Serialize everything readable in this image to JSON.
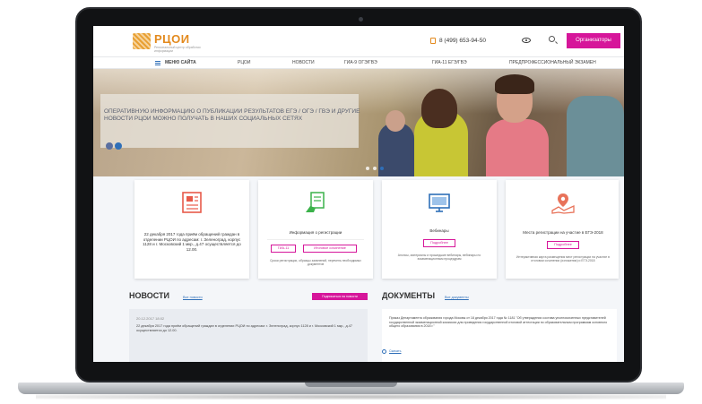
{
  "header": {
    "logo_text": "РЦОИ",
    "logo_sub": "Региональный центр обработки информации",
    "phone": "8 (499) 653-94-50",
    "organizers_label": "Организаторы"
  },
  "nav": {
    "items": [
      {
        "label": "МЕНЮ САЙТА"
      },
      {
        "label": "РЦОИ"
      },
      {
        "label": "НОВОСТИ"
      },
      {
        "label": "ГИА-9 ОГЭ/ГВЭ"
      },
      {
        "label": "ГИА-11 ЕГЭ/ГВЭ"
      },
      {
        "label": "ПРЕДПРОФЕССИОНАЛЬНЫЙ ЭКЗАМЕН"
      }
    ]
  },
  "hero": {
    "text": "ОПЕРАТИВНУЮ ИНФОРМАЦИЮ О ПУБЛИКАЦИИ РЕЗУЛЬТАТОВ ЕГЭ / ОГЭ / ГВЭ И ДРУГИЕ НОВОСТИ РЦОИ МОЖНО ПОЛУЧАТЬ В НАШИХ СОЦИАЛЬНЫХ СЕТЯХ"
  },
  "cards": [
    {
      "title": "22 декабря 2017 года приём обращений граждан в отделении РЦОИ по адресам: г. Зеленоград, корпус 1128 и г. Московский 1 мкр., д.47 осуществляется до 12.00."
    },
    {
      "title": "Информация о регистрации",
      "btn1": "ГИА-11",
      "btn2": "Итоговое сочинение",
      "desc": "Сроки регистрации, образцы заявлений, перечень необходимых документов"
    },
    {
      "title": "Вебинары",
      "btn1": "Подробнее",
      "desc": "Анонсы, материалы и прошедшие вебинары, вебинары по экзаменационным процедурам"
    },
    {
      "title": "Места регистрации на участие в ЕГЭ-2018",
      "btn1": "Подробнее",
      "desc": "Интерактивная карта размещения мест регистрации на участие в итоговом сочинении (изложении) и ЕГЭ-2018"
    }
  ],
  "news": {
    "title": "НОВОСТИ",
    "all_link": "Все новости",
    "subscribe": "Подписаться на новости",
    "date": "20.12.2017 18:02",
    "text": "22 декабря 2017 года приём обращений граждан в отделении РЦОИ по адресам: г. Зеленоград, корпус 1128 и г. Московский 1 мкр., д.47 осуществляется до 12.00."
  },
  "documents": {
    "title": "ДОКУМЕНТЫ",
    "all_link": "Все документы",
    "text": "Приказ Департамента образования города Москвы от 18 декабря 2017 года № 1181 \"Об утверждении состава уполномоченных представителей государственной экзаменационной комиссии для проведения государственной итоговой аттестации по образовательным программам основного общего образования в 2018 г.\"",
    "link": "Скачать"
  },
  "colors": {
    "accent": "#d6169a",
    "brand": "#e38a1e",
    "link": "#2f6fb8"
  }
}
